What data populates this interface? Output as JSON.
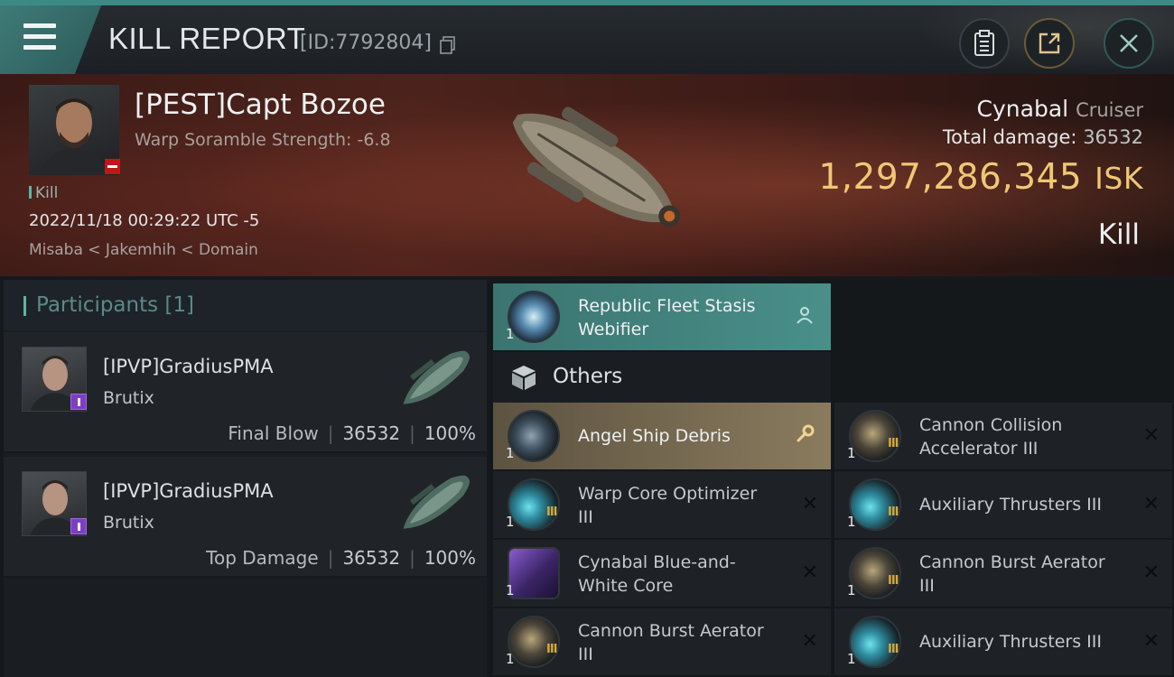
{
  "topbar": {
    "title": "KILL REPORT",
    "kill_id": "[ID:7792804]"
  },
  "victim": {
    "name": "[PEST]Capt Bozoe",
    "scramble": "Warp Soramble Strength: -6.8",
    "kill_tag": "Kill",
    "datetime": "2022/11/18 00:29:22 UTC -5",
    "location": "Misaba < Jakemhih < Domain"
  },
  "ship": {
    "name": "Cynabal",
    "class": "Cruiser",
    "damage_label": "Total damage:",
    "damage_value": "36532",
    "isk_value": "1,297,286,345",
    "isk_unit": "ISK",
    "result": "Kill"
  },
  "participants": {
    "header": "Participants [1]",
    "items": [
      {
        "name": "[IPVP]GradiusPMA",
        "ship": "Brutix",
        "role": "Final Blow",
        "damage": "36532",
        "percent": "100%"
      },
      {
        "name": "[IPVP]GradiusPMA",
        "ship": "Brutix",
        "role": "Top Damage",
        "damage": "36532",
        "percent": "100%"
      }
    ]
  },
  "items": {
    "webifier": {
      "label": "Republic Fleet Stasis Webifier",
      "qty": "1"
    },
    "others_label": "Others",
    "list": [
      {
        "label": "Angel Ship Debris",
        "qty": "1"
      },
      {
        "label": "Cannon Collision Accelerator III",
        "qty": "1"
      },
      {
        "label": "Warp Core Optimizer III",
        "qty": "1"
      },
      {
        "label": "Auxiliary Thrusters III",
        "qty": "1"
      },
      {
        "label": "Cynabal Blue-and-White Core",
        "qty": "1"
      },
      {
        "label": "Cannon Burst Aerator III",
        "qty": "1"
      },
      {
        "label": "Cannon Burst Aerator III",
        "qty": "1"
      },
      {
        "label": "Auxiliary Thrusters III",
        "qty": "1"
      }
    ],
    "tier_mark": "III"
  },
  "colors": {
    "accent_teal": "#3c8a86",
    "isk_gold": "#f0c775",
    "victim_badge": "#c0161a",
    "corp_badge": "#7d3ec3",
    "destroyed_item": "#4a8f8a",
    "dropped_item": "#8a7b5e"
  },
  "icons": {
    "menu": "hamburger-icon",
    "copy": "copy-icon",
    "clipboard": "clipboard-icon",
    "share": "share-icon",
    "close": "close-icon",
    "person": "person-icon",
    "wrench": "wrench-icon",
    "box": "box-icon",
    "remove": "x-icon"
  }
}
